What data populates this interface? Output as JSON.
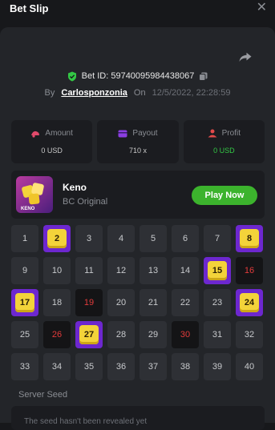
{
  "header": {
    "title": "Bet Slip",
    "close_icon": "close-icon"
  },
  "bet": {
    "id_label": "Bet ID: 59740095984438067",
    "by_label": "By",
    "user": "Carlosponzonia",
    "on_label": "On",
    "date": "12/5/2022, 22:28:59"
  },
  "stats": [
    {
      "label": "Amount",
      "value": "0 USD",
      "icon": "amount-icon",
      "color": "#e24a6b"
    },
    {
      "label": "Payout",
      "value": "710 x",
      "icon": "payout-icon",
      "color": "#8b3ee0"
    },
    {
      "label": "Profit",
      "value": "0 USD",
      "icon": "profit-icon",
      "color": "#e24a4a"
    }
  ],
  "game": {
    "name": "Keno",
    "subtitle": "BC Original",
    "play_label": "Play Now",
    "icon_text": "KENO"
  },
  "keno": {
    "numbers": [
      1,
      2,
      3,
      4,
      5,
      6,
      7,
      8,
      9,
      10,
      11,
      12,
      13,
      14,
      15,
      16,
      17,
      18,
      19,
      20,
      21,
      22,
      23,
      24,
      25,
      26,
      27,
      28,
      29,
      30,
      31,
      32,
      33,
      34,
      35,
      36,
      37,
      38,
      39,
      40
    ],
    "hits": [
      2,
      8,
      15,
      17,
      24,
      27
    ],
    "drawn_misses": [
      16,
      19,
      26,
      30
    ],
    "hit_color": "#6d27cf",
    "ball_color": "#f3d33a",
    "miss_color": "#e23b3b"
  },
  "seed": {
    "label": "Server Seed",
    "text": "The seed hasn't been revealed yet"
  }
}
